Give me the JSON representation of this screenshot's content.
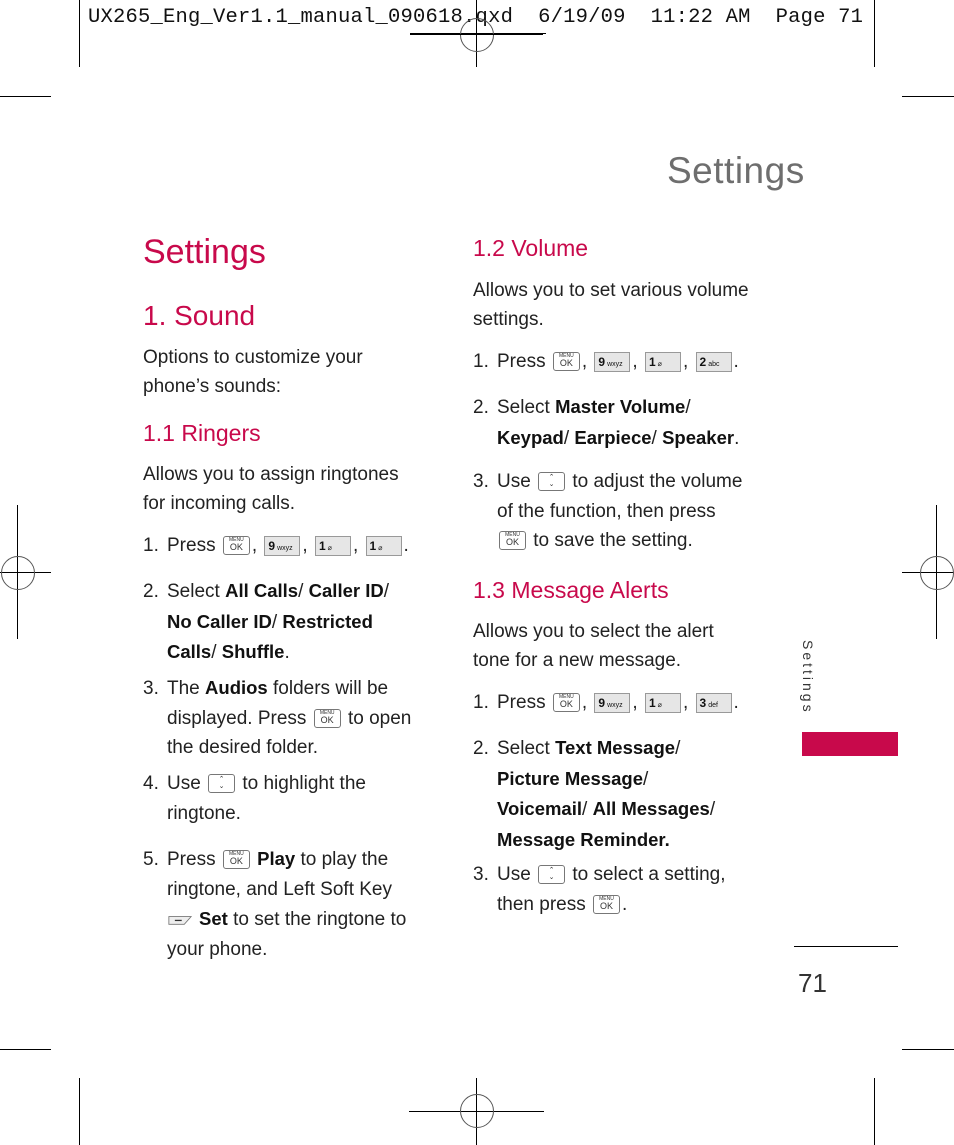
{
  "slug": {
    "file": "UX265_Eng_Ver1.1_manual_090618.qxd",
    "date": "6/19/09",
    "time": "11:22 AM",
    "page_label": "Page 71"
  },
  "running_head": "Settings",
  "side_tab": {
    "label": "Settings",
    "color": "#c8094b"
  },
  "page_number": "71",
  "accent_color": "#c8094b",
  "keys": {
    "menu_top": "MENU",
    "menu_bottom": "OK",
    "k9": "9",
    "k9_sub": "wxyz",
    "k1": "1",
    "k1_sub": "⌀",
    "k2": "2",
    "k2_sub": "abc",
    "k3": "3",
    "k3_sub": "def",
    "nav_up": "⌃",
    "nav_down": "⌄"
  },
  "left": {
    "title": "Settings",
    "section": "1. Sound",
    "section_desc_1": "Options to customize your",
    "section_desc_2": "phone’s sounds:",
    "sub_title": "1.1 Ringers",
    "sub_desc_1": "Allows you to assign ringtones",
    "sub_desc_2": "for incoming calls.",
    "steps": {
      "s1": {
        "num": "1.",
        "text": "Press"
      },
      "s2": {
        "num": "2.",
        "pre": "Select ",
        "b1": "All Calls",
        "sep1": "/ ",
        "b2": "Caller ID",
        "sep2": "/",
        "b3": "No Caller ID",
        "sep3": "/ ",
        "b4": "Restricted",
        "b5": "Calls",
        "sep4": "/ ",
        "b6": "Shuffle",
        "end": "."
      },
      "s3": {
        "num": "3.",
        "pre": "The ",
        "b1": "Audios",
        "post": " folders will be",
        "l2a": "displayed. Press",
        "l2b": " to open",
        "l3": "the desired folder."
      },
      "s4": {
        "num": "4.",
        "pre": "Use",
        "post": " to highlight the",
        "l2": "ringtone."
      },
      "s5": {
        "num": "5.",
        "pre": "Press",
        "b1": "Play",
        "post": " to play the",
        "l2": "ringtone, and Left Soft Key",
        "b2": "Set",
        "l3post": " to set the ringtone to",
        "l4": "your phone."
      }
    }
  },
  "right": {
    "volume": {
      "title": "1.2 Volume",
      "desc_1": "Allows you to set various volume",
      "desc_2": "settings.",
      "s1": {
        "num": "1.",
        "text": "Press"
      },
      "s2": {
        "num": "2.",
        "pre": "Select ",
        "b1": "Master Volume",
        "sep1": "/",
        "b2": "Keypad",
        "sep2": "/ ",
        "b3": "Earpiece",
        "sep3": "/ ",
        "b4": "Speaker",
        "end": "."
      },
      "s3": {
        "num": "3.",
        "pre": "Use",
        "post": " to adjust the volume",
        "l2": "of the function, then press",
        "l3": " to save the setting."
      }
    },
    "alerts": {
      "title": "1.3 Message Alerts",
      "desc_1": "Allows you to select the alert",
      "desc_2": "tone for a new message.",
      "s1": {
        "num": "1.",
        "text": "Press"
      },
      "s2": {
        "num": "2.",
        "pre": "Select ",
        "b1": "Text Message",
        "sep1": "/",
        "b2": "Picture Message",
        "sep2": "/",
        "b3": "Voicemail",
        "sep3": "/ ",
        "b4": "All Messages",
        "sep4": "/",
        "b5": "Message Reminder."
      },
      "s3": {
        "num": "3.",
        "pre": "Use",
        "post": " to select a setting,",
        "l2": "then press",
        "end": "."
      }
    }
  }
}
